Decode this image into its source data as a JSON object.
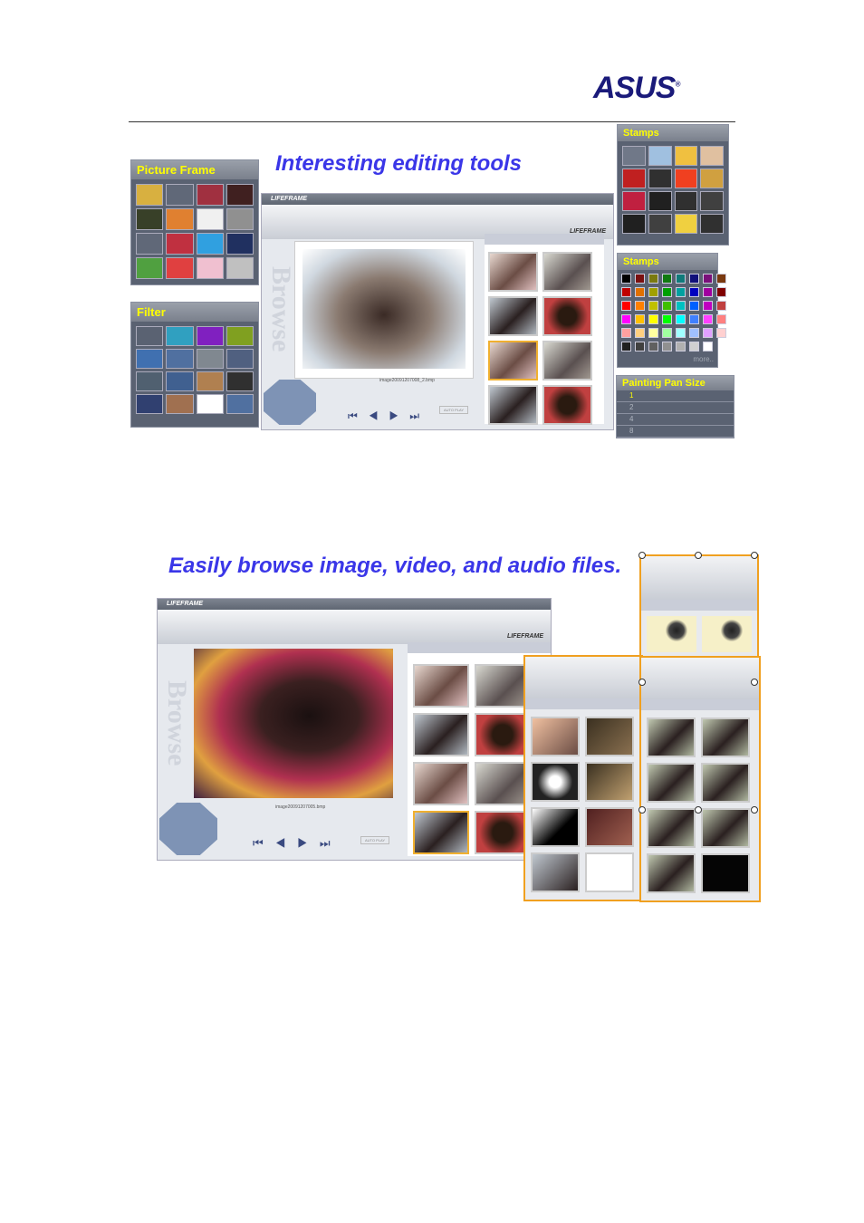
{
  "logo": "ASUS",
  "section1": {
    "heading": "Interesting editing tools"
  },
  "picture_frame": {
    "title": "Picture Frame"
  },
  "filter": {
    "title": "Filter"
  },
  "stamps1": {
    "title": "Stamps"
  },
  "stamps2": {
    "title": "Stamps",
    "more": "more.."
  },
  "pen_size": {
    "title": "Painting Pan Size",
    "options": [
      "1",
      "2",
      "4",
      "8"
    ],
    "selected": "1"
  },
  "app1": {
    "title": "LIFEFRAME",
    "brand": "LIFEFRAME",
    "browse": "Browse",
    "filename": "image20091207008_2.bmp",
    "auto_play": "AUTO PLAY"
  },
  "section2": {
    "heading": "Easily browse image, video, and audio files."
  },
  "app2": {
    "title": "LIFEFRAME",
    "brand": "LIFEFRAME",
    "browse": "Browse",
    "filename": "image20091207005.bmp",
    "auto_play": "AUTO PLAY"
  },
  "colors": {
    "heading": "#3a36e8",
    "panel_title": "#ffff00",
    "highlight": "#f0a020"
  },
  "palette": [
    "#000000",
    "#7a1010",
    "#7a7a10",
    "#107a10",
    "#107a7a",
    "#10107a",
    "#7a107a",
    "#7a3a10",
    "#c00000",
    "#e07000",
    "#a0a000",
    "#00a000",
    "#00a0a0",
    "#0000c0",
    "#a000a0",
    "#800000",
    "#ff0000",
    "#ff8000",
    "#c0c000",
    "#40c000",
    "#00c0c0",
    "#0060ff",
    "#c000c0",
    "#c04040",
    "#ff00ff",
    "#ffc000",
    "#ffff00",
    "#00ff00",
    "#00ffff",
    "#4080ff",
    "#ff40ff",
    "#ff8080",
    "#ffa0a0",
    "#ffd080",
    "#ffffa0",
    "#a0ffa0",
    "#a0ffff",
    "#a0c0ff",
    "#e0a0ff",
    "#ffd0d0",
    "#202020",
    "#404040",
    "#606060",
    "#909090",
    "#b0b0b0",
    "#d0d0d0",
    "#ffffff"
  ]
}
